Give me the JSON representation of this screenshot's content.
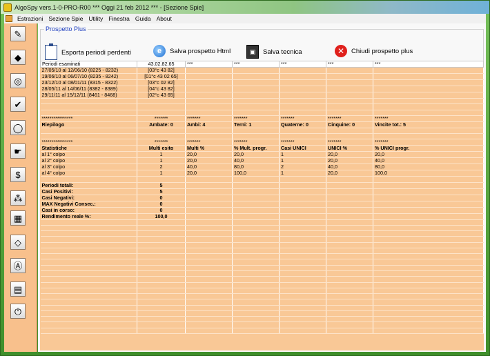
{
  "window": {
    "title": "AlgoSpy vers.1-0-PRO-R00  ***  Oggi 21 feb 2012  ***  - [Sezione Spie]"
  },
  "menu": [
    "Estrazioni",
    "Sezione Spie",
    "Utility",
    "Finestra",
    "Guida",
    "About"
  ],
  "toolstrip": [
    {
      "name": "pencil-icon",
      "glyph": "✎"
    },
    {
      "name": "eraser-icon",
      "glyph": "◆"
    },
    {
      "name": "circle-target-icon",
      "glyph": "◎"
    },
    {
      "name": "check-icon",
      "glyph": "✔"
    },
    {
      "name": "lightbulb-icon",
      "glyph": "◯"
    },
    {
      "name": "hand-pointer-icon",
      "glyph": "☛"
    },
    {
      "name": "dollar-icon",
      "glyph": "$"
    },
    {
      "name": "network-icon",
      "glyph": "⁂"
    },
    {
      "name": "grid-icon",
      "glyph": "▦"
    },
    {
      "name": "diamond-icon",
      "glyph": "◇"
    },
    {
      "name": "letter-a-icon",
      "glyph": "Ⓐ"
    },
    {
      "name": "book-icon",
      "glyph": "▤"
    },
    {
      "name": "power-icon",
      "glyph": "⏻"
    }
  ],
  "group_title": "Prospetto Plus",
  "actions": {
    "export": "Esporta periodi perdenti",
    "save_html": "Salva prospetto Html",
    "save_tech": "Salva tecnica",
    "close": "Chiudi prospetto plus"
  },
  "table": {
    "header": [
      "Periodi esaminati",
      "43.02.82.65",
      "***",
      "***",
      "***",
      "***",
      "***"
    ],
    "periods": [
      [
        "27/05/10 al 12/06/10  (8225 - 8232)",
        "[03°c 43 82]"
      ],
      [
        "19/06/10 al 06/07/10  (8235 - 8242)",
        "[01°c 43 02 65]"
      ],
      [
        "23/12/10 al 08/01/11  (8315 - 8322)",
        "[03°c 02 82]"
      ],
      [
        "28/05/11 al 14/06/11  (8382 - 8389)",
        "[04°c 43 82]"
      ],
      [
        "29/11/11 al 15/12/11  (8461 - 8468)",
        "[02°c 43 65]"
      ]
    ],
    "stars_long": "****************",
    "stars_short": "*******",
    "riepilogo": [
      "Riepilogo",
      "Ambate: 0",
      "Ambi: 4",
      "Terni: 1",
      "Quaterne: 0",
      "Cinquine: 0",
      "Vincite tot.: 5"
    ],
    "stat_header": [
      "Statistiche",
      "Multi esito",
      "Multi %",
      "% Mult. progr.",
      "Casi UNICI",
      "UNICI %",
      "% UNICI progr."
    ],
    "stats": [
      [
        "al 1° colpo",
        "1",
        "20,0",
        "20,0",
        "1",
        "20,0",
        "20,0"
      ],
      [
        "al 2° colpo",
        "1",
        "20,0",
        "40,0",
        "1",
        "20,0",
        "40,0"
      ],
      [
        "al 3° colpo",
        "2",
        "40,0",
        "80,0",
        "2",
        "40,0",
        "80,0"
      ],
      [
        "al 4° colpo",
        "1",
        "20,0",
        "100,0",
        "1",
        "20,0",
        "100,0"
      ]
    ],
    "totals": [
      [
        "Periodi totali:",
        "5"
      ],
      [
        "Casi Positivi:",
        "5"
      ],
      [
        "Casi Negativi:",
        "0"
      ],
      [
        "MAX Negativi Consec.:",
        "0"
      ],
      [
        "Casi in corso:",
        "0"
      ]
    ],
    "rendimento": [
      "Rendimento reale %:",
      "100,0"
    ]
  }
}
